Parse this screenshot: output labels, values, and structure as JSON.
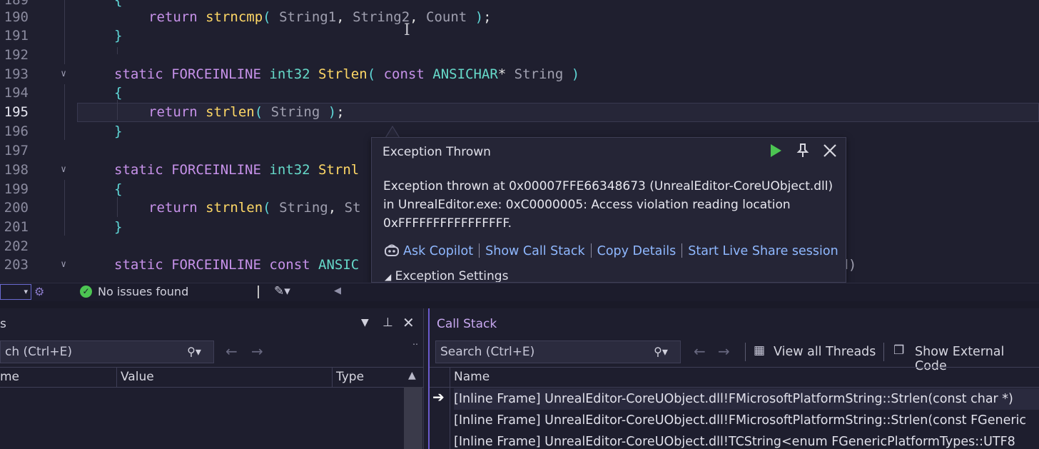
{
  "editor": {
    "lines": [
      {
        "num": "189",
        "text": "{"
      },
      {
        "num": "190",
        "text": "return strncmp( String1, String2, Count );"
      },
      {
        "num": "191",
        "text": "}"
      },
      {
        "num": "192",
        "text": ""
      },
      {
        "num": "193",
        "text": "static FORCEINLINE int32 Strlen( const ANSICHAR* String )"
      },
      {
        "num": "194",
        "text": "{"
      },
      {
        "num": "195",
        "text": "return strlen( String );"
      },
      {
        "num": "196",
        "text": "}"
      },
      {
        "num": "197",
        "text": ""
      },
      {
        "num": "198",
        "text": "static FORCEINLINE int32 Strnl"
      },
      {
        "num": "199",
        "text": "{"
      },
      {
        "num": "200",
        "text": "return strnlen( String, St"
      },
      {
        "num": "201",
        "text": "}"
      },
      {
        "num": "202",
        "text": ""
      },
      {
        "num": "203",
        "text": "static FORCEINLINE const ANSIC"
      }
    ],
    "hidden_tail": "nd)"
  },
  "statusbar": {
    "issues": "No issues found"
  },
  "exception": {
    "title": "Exception Thrown",
    "message_line1": "Exception thrown at 0x00007FFE66348673 (UnrealEditor-CoreUObject.dll)",
    "message_line2": "in UnrealEditor.exe: 0xC0000005: Access violation reading location",
    "message_line3": "0xFFFFFFFFFFFFFFFF.",
    "links": {
      "ask_copilot": "Ask Copilot",
      "show_call_stack": "Show Call Stack",
      "copy_details": "Copy Details",
      "live_share": "Start Live Share session"
    },
    "settings": "Exception Settings"
  },
  "locals": {
    "title": "s",
    "search_placeholder": "ch (Ctrl+E)",
    "columns": [
      "me",
      "Value",
      "Type"
    ]
  },
  "callstack": {
    "title": "Call Stack",
    "search_placeholder": "Search (Ctrl+E)",
    "view_all_threads": "View all Threads",
    "show_external_code": "Show External Code",
    "column_name": "Name",
    "frames": [
      "[Inline Frame] UnrealEditor-CoreUObject.dll!FMicrosoftPlatformString::Strlen(const char *)",
      "[Inline Frame] UnrealEditor-CoreUObject.dll!FMicrosoftPlatformString::Strlen(const FGeneric",
      "[Inline Frame] UnrealEditor-CoreUObject.dll!TCString<enum FGenericPlatformTypes::UTF8"
    ]
  },
  "colors": {
    "accent_play": "#4cc552",
    "link": "#8fb8ff",
    "panel_accent": "#6a5acd"
  }
}
